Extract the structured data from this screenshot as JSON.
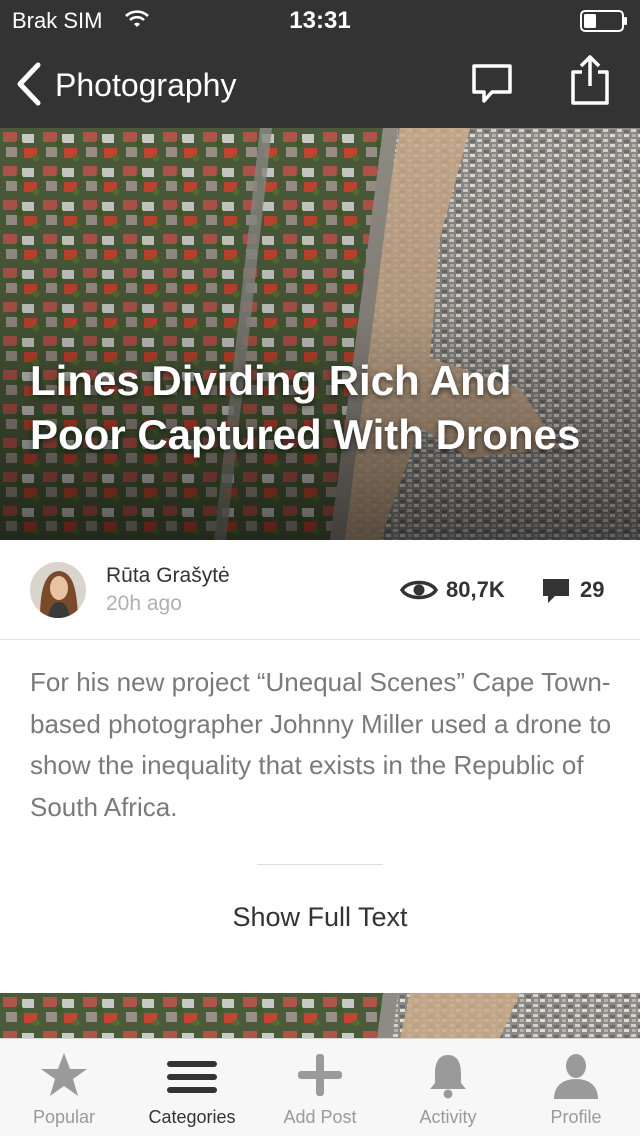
{
  "status_bar": {
    "carrier": "Brak SIM",
    "time": "13:31"
  },
  "nav": {
    "title": "Photography"
  },
  "article": {
    "headline": "Lines Dividing Rich And Poor Captured With Drones",
    "author": "Rūta Grašytė",
    "time_ago": "20h ago",
    "views": "80,7K",
    "comments": "29",
    "excerpt": "For his new project “Unequal Scenes” Cape Town-based photographer Johnny Miller used a drone to show the inequality that exists in the Republic of South Africa.",
    "show_full_label": "Show Full Text"
  },
  "tabs": [
    {
      "label": "Popular",
      "icon": "star-icon",
      "active": false
    },
    {
      "label": "Categories",
      "icon": "menu-icon",
      "active": true
    },
    {
      "label": "Add Post",
      "icon": "plus-icon",
      "active": false
    },
    {
      "label": "Activity",
      "icon": "bell-icon",
      "active": false
    },
    {
      "label": "Profile",
      "icon": "person-icon",
      "active": false
    }
  ],
  "colors": {
    "nav_bg": "#333333",
    "tab_active": "#333333",
    "tab_inactive": "#9a9a9a",
    "excerpt_text": "#7a7a7a"
  }
}
